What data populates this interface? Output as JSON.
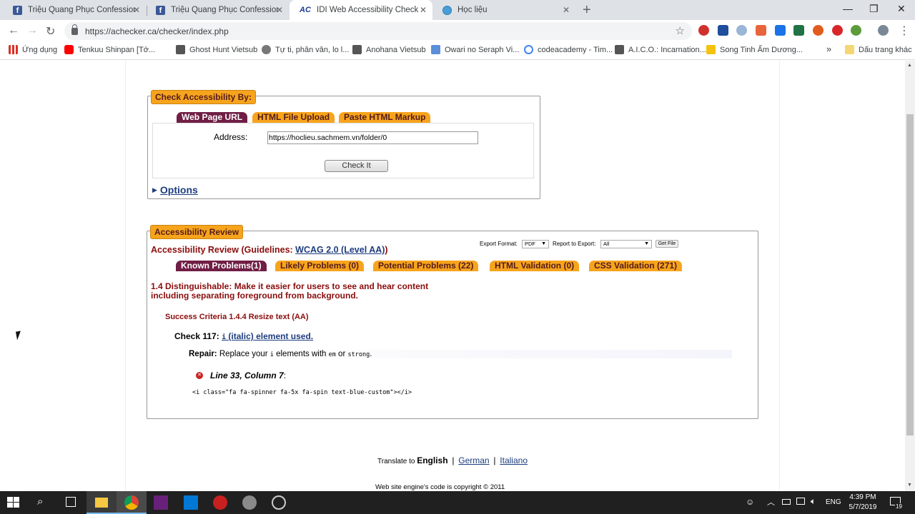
{
  "browser": {
    "tabs": [
      {
        "title": "Triệu Quang Phục Confessions",
        "favicon": "facebook-icon",
        "active": false
      },
      {
        "title": "Triệu Quang Phục Confessions",
        "favicon": "facebook-icon",
        "active": false
      },
      {
        "title": "IDI Web Accessibility Checker : W",
        "favicon": "achecker-icon",
        "active": true
      },
      {
        "title": "Học liệu",
        "favicon": "globe-icon",
        "active": false
      }
    ],
    "favicon_ac": "AC",
    "favicon_fb": "f",
    "url": "https://achecker.ca/checker/index.php",
    "bookmarks": [
      {
        "label": "Ứng dụng",
        "icon": "apps-grid-icon"
      },
      {
        "label": "Tenkuu Shinpan [Tớ...",
        "icon": "youtube-icon"
      },
      {
        "label": "Ghost Hunt Vietsub",
        "icon": "bookmark-icon"
      },
      {
        "label": "Tự ti, phân vân, lo l...",
        "icon": "bookmark-icon"
      },
      {
        "label": "Anohana Vietsub",
        "icon": "bookmark-icon"
      },
      {
        "label": "Owari no Seraph Vi...",
        "icon": "bookmark-icon"
      },
      {
        "label": "codeacademy - Tim...",
        "icon": "google-icon"
      },
      {
        "label": "A.I.C.O.: Incarnation...",
        "icon": "bookmark-icon"
      },
      {
        "label": "Song Tinh Ấm Dương...",
        "icon": "bookmark-icon"
      },
      {
        "label": "Dấu trang khác",
        "icon": "folder-icon"
      }
    ],
    "bookmarks_more": "»"
  },
  "checker": {
    "legend": "Check Accessibility By:",
    "tabs": [
      "Web Page URL",
      "HTML File Upload",
      "Paste HTML Markup"
    ],
    "address_label": "Address:",
    "address_value": "https://hoclieu.sachmem.vn/folder/0",
    "check_button": "Check It",
    "options_label": "Options"
  },
  "review": {
    "legend": "Accessibility Review",
    "heading_prefix": "Accessibility Review (Guidelines: ",
    "guideline_link": "WCAG 2.0 (Level AA)",
    "heading_suffix": ")",
    "export_format_label": "Export Format:",
    "export_format_value": "PDF",
    "report_label": "Report to Export:",
    "report_value": "All",
    "get_file": "Get File",
    "tabs": [
      "Known Problems(1)",
      "Likely Problems (0)",
      "Potential Problems (22)",
      "HTML Validation (0)",
      "CSS Validation (271)"
    ],
    "guideline_title": "1.4 Distinguishable: Make it easier for users to see and hear content including separating foreground from background.",
    "criteria": "Success Criteria 1.4.4 Resize text (AA)",
    "check_label": "Check 117:",
    "check_link_code": "i",
    "check_link_text": " (italic) element used.",
    "repair_label": "Repair:",
    "repair_text_1": " Replace your ",
    "repair_code_1": "i",
    "repair_text_2": " elements with ",
    "repair_code_2": "em",
    "repair_text_3": " or ",
    "repair_code_3": "strong",
    "repair_text_4": ".",
    "location": "Line 33, Column 7",
    "location_suffix": ":",
    "code_snippet": "<i class=\"fa fa-spinner fa-5x fa-spin text-blue-custom\"></i>"
  },
  "footer": {
    "translate_label": "Translate to ",
    "lang_current": "English",
    "sep": "|",
    "lang_german": "German",
    "lang_italian": "Italiano",
    "copyright": "Web site engine's code is copyright © 2011"
  },
  "taskbar": {
    "language": "ENG",
    "time": "4:39 PM",
    "date": "5/7/2019",
    "notifications": "19"
  }
}
